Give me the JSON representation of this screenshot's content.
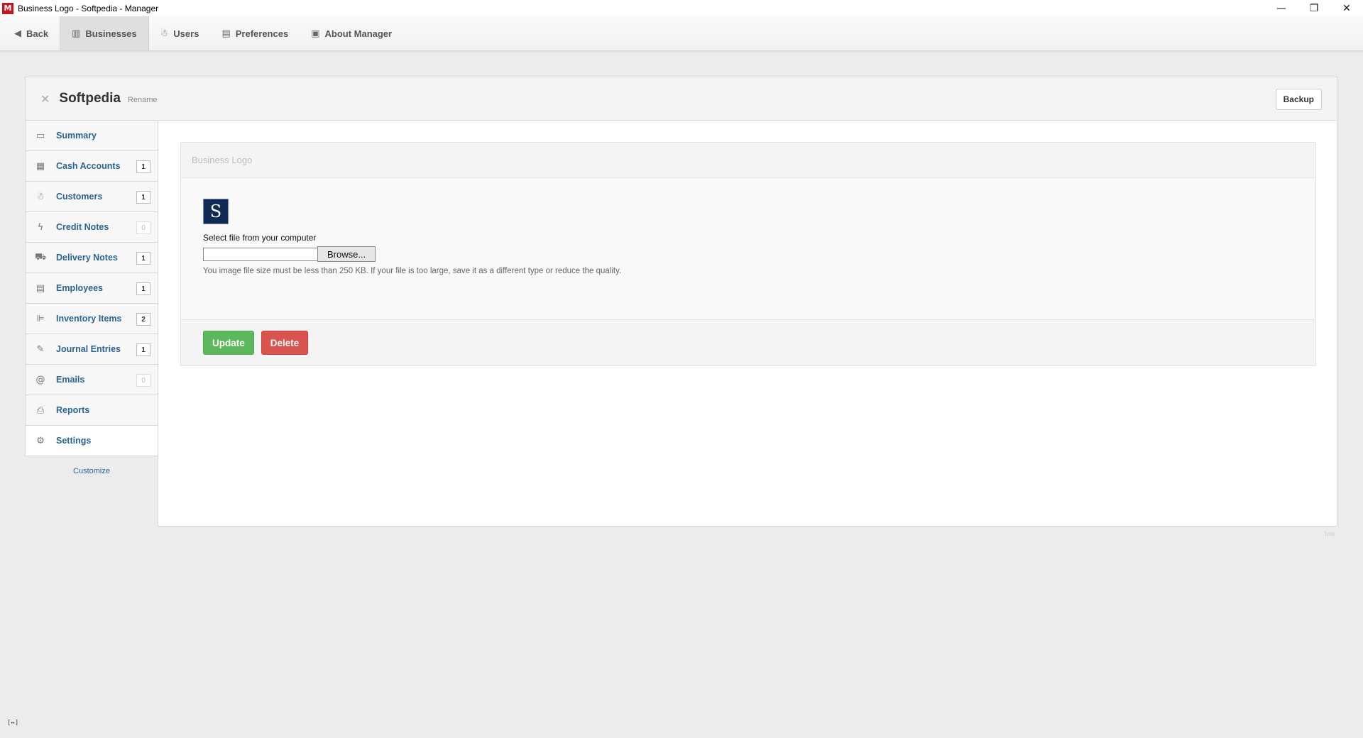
{
  "window": {
    "title": "Business Logo - Softpedia - Manager",
    "app_icon": "M",
    "minimize": "—",
    "restore": "❐",
    "close": "✕"
  },
  "nav": {
    "back": "Back",
    "businesses": "Businesses",
    "users": "Users",
    "preferences": "Preferences",
    "about": "About Manager"
  },
  "business": {
    "name": "Softpedia",
    "rename": "Rename",
    "backup": "Backup"
  },
  "sidebar": {
    "items": [
      {
        "label": "Summary",
        "icon": "presentation-icon",
        "badge": null
      },
      {
        "label": "Cash Accounts",
        "icon": "cash-icon",
        "badge": "1"
      },
      {
        "label": "Customers",
        "icon": "people-icon",
        "badge": "1"
      },
      {
        "label": "Credit Notes",
        "icon": "lightning-icon",
        "badge": "0"
      },
      {
        "label": "Delivery Notes",
        "icon": "truck-icon",
        "badge": "1"
      },
      {
        "label": "Employees",
        "icon": "id-card-icon",
        "badge": "1"
      },
      {
        "label": "Inventory Items",
        "icon": "inventory-icon",
        "badge": "2"
      },
      {
        "label": "Journal Entries",
        "icon": "pen-icon",
        "badge": "1"
      },
      {
        "label": "Emails",
        "icon": "at-icon",
        "badge": "0"
      },
      {
        "label": "Reports",
        "icon": "printer-icon",
        "badge": null
      },
      {
        "label": "Settings",
        "icon": "gears-icon",
        "badge": null
      }
    ],
    "customize": "Customize"
  },
  "panel": {
    "title": "Business Logo",
    "logo_letter": "S",
    "file_label": "Select file from your computer",
    "file_value": "",
    "browse": "Browse...",
    "hint": "You image file size must be less than 250 KB. If your file is too large, save it as a different type or reduce the quality.",
    "update": "Update",
    "delete": "Delete"
  },
  "footer": {
    "timing": "1ms",
    "status_icon": "[↔]"
  }
}
